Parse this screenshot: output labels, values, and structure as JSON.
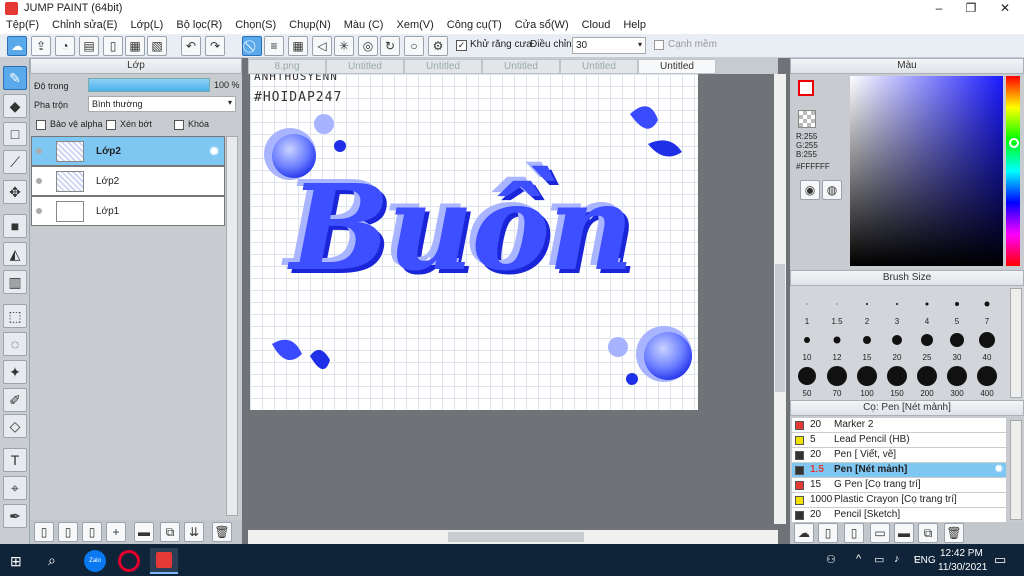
{
  "app": {
    "title": "JUMP PAINT (64bit)",
    "min": "–",
    "max": "❐",
    "close": "✕"
  },
  "menu": [
    "Tệp(F)",
    "Chỉnh sửa(E)",
    "Lớp(L)",
    "Bộ lọc(R)",
    "Chọn(S)",
    "Chụp(N)",
    "Màu (C)",
    "Xem(V)",
    "Công cụ(T)",
    "Cửa sổ(W)",
    "Cloud",
    "Help"
  ],
  "toolbar": {
    "antialias_label": "Khử răng cưa",
    "adjust_label": "Điều chỉnh",
    "adjust_value": "30",
    "snap_label": "Cạnh mềm"
  },
  "layers": {
    "title": "Lớp",
    "opacity_label": "Độ trong",
    "opacity_value": "100 %",
    "blend_label": "Pha trộn",
    "blend_value": "Bình thường",
    "protect_alpha": "Bảo vệ alpha",
    "clip": "Xén bớt",
    "lock": "Khóa",
    "items": [
      {
        "name": "Lớp2",
        "selected": true
      },
      {
        "name": "Lớp2",
        "selected": false
      },
      {
        "name": "Lớp1",
        "selected": false
      }
    ]
  },
  "tabs": [
    "8.png",
    "Untitled",
    "Untitled",
    "Untitled",
    "Untitled",
    "Untitled"
  ],
  "canvas": {
    "artwork_text": "Buồn",
    "hashtag": "#HOIDAP247",
    "top_text": "ANHTHUSYENN"
  },
  "color": {
    "title": "Màu",
    "r": "R:255",
    "g": "G:255",
    "b": "B:255",
    "hex": "#FFFFFF",
    "primary": "#ff0000",
    "gradient_hue": "#1a1aff"
  },
  "brush_size": {
    "title": "Brush Size",
    "sizes": [
      "1",
      "1.5",
      "2",
      "3",
      "4",
      "5",
      "7",
      "10",
      "12",
      "15",
      "20",
      "25",
      "30",
      "40",
      "50",
      "70",
      "100",
      "150",
      "200",
      "300",
      "400"
    ]
  },
  "pens": {
    "title": "Cọ: Pen [Nét mảnh]",
    "items": [
      {
        "size": "20",
        "name": "Marker 2",
        "color": "#e53935",
        "selected": false
      },
      {
        "size": "5",
        "name": "Lead Pencil (HB)",
        "color": "#f2e200",
        "selected": false
      },
      {
        "size": "20",
        "name": "Pen [ Viết, vẽ]",
        "color": "#333333",
        "selected": false
      },
      {
        "size": "1.5",
        "name": "Pen [Nét mảnh]",
        "color": "#333333",
        "selected": true
      },
      {
        "size": "15",
        "name": "G Pen [Cọ trang trí]",
        "color": "#e53935",
        "selected": false
      },
      {
        "size": "1000",
        "name": "Plastic Crayon [Cọ trang trí]",
        "color": "#f2e200",
        "selected": false
      },
      {
        "size": "20",
        "name": "Pencil [Sketch]",
        "color": "#333333",
        "selected": false
      }
    ]
  },
  "taskbar": {
    "lang": "ENG",
    "time": "12:42 PM",
    "date": "11/30/2021",
    "zalo": "Zalo"
  }
}
